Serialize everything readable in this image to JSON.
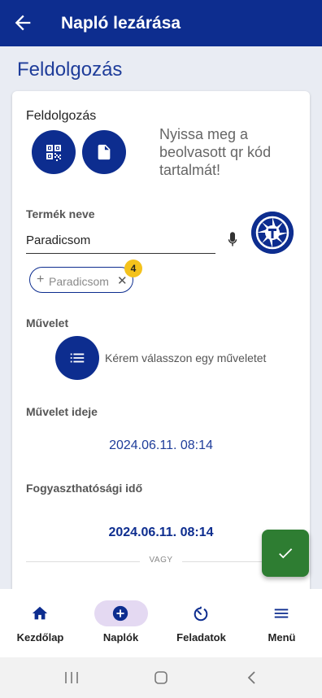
{
  "appbar": {
    "title": "Napló lezárása",
    "back_icon": "arrow-left-icon"
  },
  "page": {
    "title": "Feldolgozás"
  },
  "processing": {
    "label": "Feldolgozás",
    "hint": "Nyissa meg a beolvasott qr kód tartalmát!",
    "qr_icon": "qr-code-icon",
    "file_icon": "file-icon"
  },
  "product": {
    "label": "Termék neve",
    "value": "Paradicsom",
    "mic_icon": "microphone-icon",
    "chip": {
      "label": "Paradicsom",
      "plus": "+",
      "close": "✕",
      "badge": "4"
    }
  },
  "operation": {
    "label": "Művelet",
    "placeholder": "Kérem válasszon egy műveletet",
    "icon": "list-icon"
  },
  "operation_time": {
    "label": "Művelet ideje",
    "value": "2024.06.11. 08:14"
  },
  "best_before": {
    "label": "Fogyaszthatósági idő",
    "value": "2024.06.11. 08:14",
    "or_text": "VAGY"
  },
  "fab": {
    "icon": "check-icon"
  },
  "bottom_nav": {
    "items": [
      {
        "label": "Kezdőlap",
        "icon": "home-icon",
        "active": false
      },
      {
        "label": "Naplók",
        "icon": "add-circle-icon",
        "active": true
      },
      {
        "label": "Feladatok",
        "icon": "timer-icon",
        "active": false
      },
      {
        "label": "Menü",
        "icon": "menu-icon",
        "active": false
      }
    ]
  },
  "colors": {
    "primary": "#0d2d8f",
    "accent_green": "#2e7d32",
    "badge": "#f4c21c",
    "active_pill": "#e4d9f2"
  }
}
